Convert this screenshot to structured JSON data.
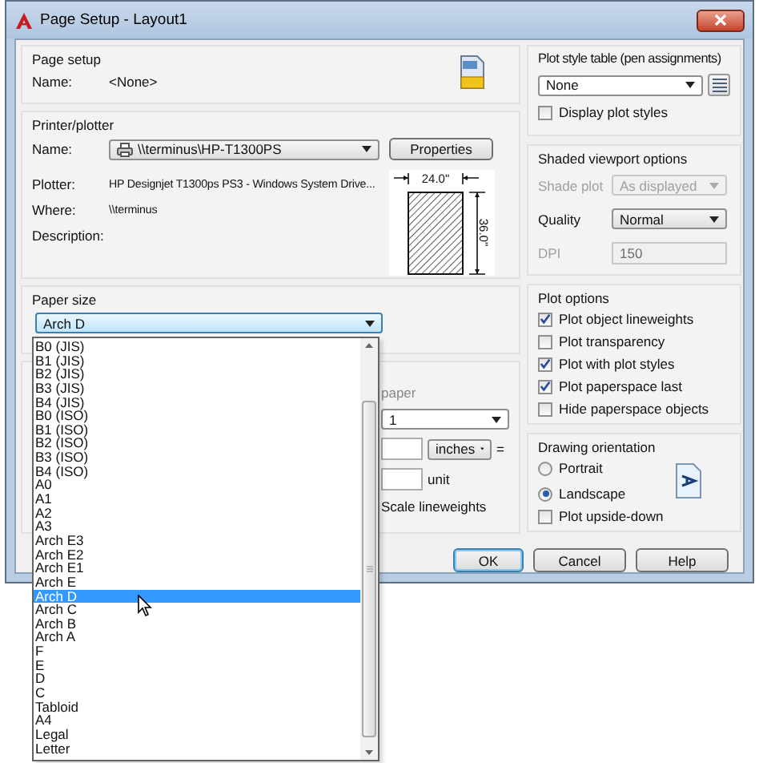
{
  "window": {
    "title": "Page Setup - Layout1"
  },
  "page_setup": {
    "title": "Page setup",
    "name_label": "Name:",
    "name_value": "<None>"
  },
  "printer": {
    "title": "Printer/plotter",
    "name_label": "Name:",
    "name_value": "\\\\terminus\\HP-T1300PS",
    "properties_button": "Properties",
    "rows": [
      {
        "label": "Plotter:",
        "value": "HP Designjet T1300ps PS3 - Windows System Drive..."
      },
      {
        "label": "Where:",
        "value": "\\\\terminus"
      },
      {
        "label": "Description:"
      }
    ],
    "preview": {
      "width": "24.0\"",
      "height": "36.0\""
    }
  },
  "paper_size": {
    "title": "Paper size",
    "value": "Arch D",
    "options": [
      {
        "label": "B0 (JIS)",
        "selected": false
      },
      {
        "label": "B1 (JIS)",
        "selected": false
      },
      {
        "label": "B2 (JIS)",
        "selected": false
      },
      {
        "label": "B3 (JIS)",
        "selected": false
      },
      {
        "label": "B4 (JIS)",
        "selected": false
      },
      {
        "label": "B0 (ISO)",
        "selected": false
      },
      {
        "label": "B1 (ISO)",
        "selected": false
      },
      {
        "label": "B2 (ISO)",
        "selected": false
      },
      {
        "label": "B3 (ISO)",
        "selected": false
      },
      {
        "label": "B4 (ISO)",
        "selected": false
      },
      {
        "label": "A0",
        "selected": false
      },
      {
        "label": "A1",
        "selected": false
      },
      {
        "label": "A2",
        "selected": false
      },
      {
        "label": "A3",
        "selected": false
      },
      {
        "label": "Arch E3",
        "selected": false
      },
      {
        "label": "Arch E2",
        "selected": false
      },
      {
        "label": "Arch E1",
        "selected": false
      },
      {
        "label": "Arch E",
        "selected": false
      },
      {
        "label": "Arch D",
        "selected": true
      },
      {
        "label": "Arch C",
        "selected": false
      },
      {
        "label": "Arch B",
        "selected": false
      },
      {
        "label": "Arch A",
        "selected": false
      },
      {
        "label": "F",
        "selected": false
      },
      {
        "label": "E",
        "selected": false
      },
      {
        "label": "D",
        "selected": false
      },
      {
        "label": "C",
        "selected": false
      },
      {
        "label": "Tabloid",
        "selected": false
      },
      {
        "label": "A4",
        "selected": false
      },
      {
        "label": "Legal",
        "selected": false
      },
      {
        "label": "Letter",
        "selected": false
      }
    ]
  },
  "scale_area": {
    "paper_fragment": "paper",
    "scale_value": "1",
    "units": "inches",
    "equals": "=",
    "unit_label": "unit",
    "scale_lineweights": "Scale lineweights"
  },
  "plot_style_table": {
    "title": "Plot style table (pen assignments)",
    "value": "None",
    "display_plot_styles": {
      "label": "Display plot styles",
      "checked": false
    }
  },
  "shaded_viewport": {
    "title": "Shaded viewport options",
    "rows": [
      {
        "label": "Shade plot",
        "value": "As displayed",
        "kind": "combo",
        "disabled": true
      },
      {
        "label": "Quality",
        "value": "Normal",
        "kind": "combo",
        "disabled": false
      },
      {
        "label": "DPI",
        "value": "150",
        "kind": "field",
        "disabled": true
      }
    ]
  },
  "plot_options": {
    "title": "Plot options",
    "items": [
      {
        "label": "Plot object lineweights",
        "checked": true
      },
      {
        "label": "Plot transparency",
        "checked": false
      },
      {
        "label": "Plot with plot styles",
        "checked": true
      },
      {
        "label": "Plot paperspace last",
        "checked": true
      },
      {
        "label": "Hide paperspace objects",
        "checked": false
      }
    ]
  },
  "orientation": {
    "title": "Drawing orientation",
    "options": [
      {
        "label": "Portrait",
        "selected": false
      },
      {
        "label": "Landscape",
        "selected": true
      }
    ],
    "upside_down": {
      "label": "Plot upside-down",
      "checked": false
    }
  },
  "buttons": [
    {
      "label": "OK",
      "default": true
    },
    {
      "label": "Cancel",
      "default": false
    },
    {
      "label": "Help",
      "default": false
    }
  ]
}
